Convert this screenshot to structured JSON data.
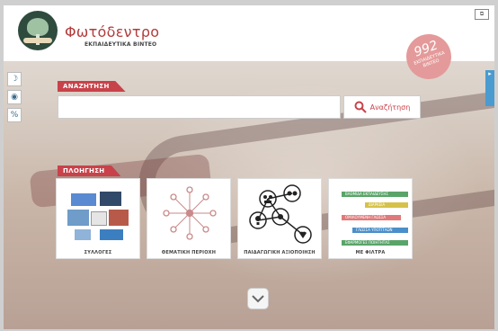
{
  "header": {
    "logo_title": "Φωτόδεντρο",
    "logo_subtitle": "ΕΚΠΑΙΔΕΥΤΙΚΑ ΒΙΝΤΕΟ",
    "badge_number": "992",
    "badge_label": "ΕΚΠΑΙΔΕΥΤΙΚΑ ΒΙΝΤΕΟ"
  },
  "search": {
    "section_label": "ΑΝΑΖΗΤΗΣΗ",
    "placeholder": "",
    "button_label": "Αναζήτηση"
  },
  "navigation": {
    "section_label": "ΠΛΟΗΓΗΣΗ",
    "cards": [
      {
        "label": "ΣΥΛΛΟΓΕΣ"
      },
      {
        "label": "ΘΕΜΑΤΙΚΗ ΠΕΡΙΟΧΗ"
      },
      {
        "label": "ΠΑΙΔΑΓΩΓΙΚΗ ΑΞΙΟΠΟΙΗΣΗ"
      },
      {
        "label": "ΜΕ ΦΙΛΤΡΑ"
      }
    ],
    "filters": [
      {
        "label": "ΒΑΘΜΙΔΑ ΕΚΠΑΙΔΕΥΣΗΣ",
        "color": "#5aa469"
      },
      {
        "label": "ΔΙΑΡΚΕΙΑ",
        "color": "#d6c24a"
      },
      {
        "label": "ΟΜΙΛΟΥΜΕΝΗ ΓΛΩΣΣΑ",
        "color": "#e07a7a"
      },
      {
        "label": "ΓΛΩΣΣΑ ΥΠΟΤΙΤΛΩΝ",
        "color": "#4a8fc9"
      },
      {
        "label": "ΕΦΑΡΜΟΓΕΣ ΠΟΙΗΤΗΤΑΣ",
        "color": "#5aa469"
      }
    ]
  },
  "colors": {
    "accent": "#c8424a",
    "brand_title": "#b23b3b"
  }
}
